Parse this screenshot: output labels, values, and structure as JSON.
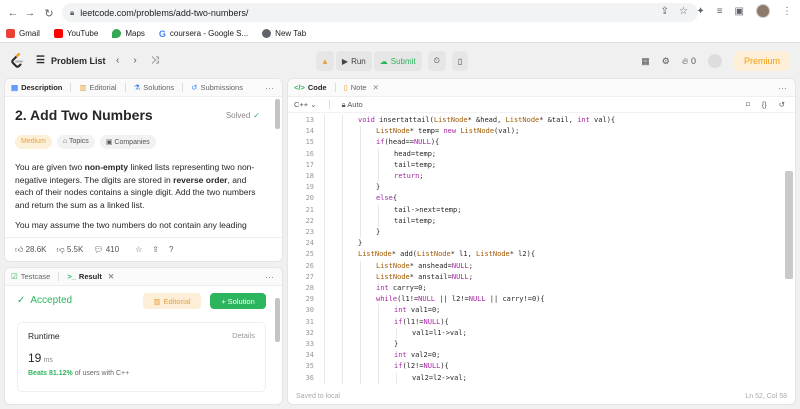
{
  "browser": {
    "url": "leetcode.com/problems/add-two-numbers/",
    "bookmarks": [
      {
        "label": "Gmail",
        "color": "#ea4335"
      },
      {
        "label": "YouTube",
        "color": "#ff0000"
      },
      {
        "label": "Maps",
        "color": "#34a853"
      },
      {
        "label": "coursera - Google S...",
        "color": "#4285f4"
      },
      {
        "label": "New Tab",
        "color": "#5f6368"
      }
    ]
  },
  "toolbar": {
    "problem_list": "Problem List",
    "run": "Run",
    "submit": "Submit",
    "streak": "0",
    "premium": "Premium"
  },
  "description_panel": {
    "tabs": [
      "Description",
      "Editorial",
      "Solutions",
      "Submissions"
    ],
    "title": "2. Add Two Numbers",
    "solved": "Solved",
    "chips": [
      "Medium",
      "Topics",
      "Companies"
    ],
    "para1_a": "You are given two ",
    "para1_b": "non-empty",
    "para1_c": " linked lists representing two non-negative integers. The digits are stored in ",
    "para1_d": "reverse order",
    "para1_e": ", and each of their nodes contains a single digit. Add the two numbers and return the sum as a linked list.",
    "para2": "You may assume the two numbers do not contain any leading",
    "likes": "28.6K",
    "dislikes": "5.5K",
    "comments": "410"
  },
  "result_panel": {
    "tabs": [
      "Testcase",
      "Result"
    ],
    "status": "Accepted",
    "editorial_btn": "Editorial",
    "solution_btn": "+ Solution",
    "runtime_label": "Runtime",
    "details": "Details",
    "runtime_value": "19",
    "runtime_unit": "ms",
    "beats_a": "Beats 81.12%",
    "beats_b": " of users with C++"
  },
  "code_panel": {
    "tabs": [
      "Code",
      "Note"
    ],
    "language": "C++",
    "auto": "Auto",
    "footer_left": "Saved to local",
    "footer_right": "Ln 52, Col 58",
    "lines": [
      {
        "n": "13",
        "indent": 2,
        "text": "void insertattail(ListNode* &head, ListNode* &tail, int val){"
      },
      {
        "n": "14",
        "indent": 3,
        "text": "ListNode* temp= new ListNode(val);"
      },
      {
        "n": "15",
        "indent": 3,
        "text": "if(head==NULL){"
      },
      {
        "n": "16",
        "indent": 4,
        "text": "head=temp;"
      },
      {
        "n": "17",
        "indent": 4,
        "text": "tail=temp;"
      },
      {
        "n": "18",
        "indent": 4,
        "text": "return;"
      },
      {
        "n": "19",
        "indent": 3,
        "text": "}"
      },
      {
        "n": "20",
        "indent": 3,
        "text": "else{"
      },
      {
        "n": "21",
        "indent": 4,
        "text": "tail->next=temp;"
      },
      {
        "n": "22",
        "indent": 4,
        "text": "tail=temp;"
      },
      {
        "n": "23",
        "indent": 3,
        "text": "}"
      },
      {
        "n": "24",
        "indent": 2,
        "text": "}"
      },
      {
        "n": "25",
        "indent": 2,
        "text": "ListNode* add(ListNode* l1, ListNode* l2){"
      },
      {
        "n": "26",
        "indent": 3,
        "text": "ListNode* anshead=NULL;"
      },
      {
        "n": "27",
        "indent": 3,
        "text": "ListNode* anstail=NULL;"
      },
      {
        "n": "28",
        "indent": 3,
        "text": "int carry=0;"
      },
      {
        "n": "29",
        "indent": 3,
        "text": "while(l1!=NULL || l2!=NULL || carry!=0){"
      },
      {
        "n": "30",
        "indent": 4,
        "text": "int val1=0;"
      },
      {
        "n": "31",
        "indent": 4,
        "text": "if(l1!=NULL){"
      },
      {
        "n": "32",
        "indent": 5,
        "text": "val1=l1->val;"
      },
      {
        "n": "33",
        "indent": 4,
        "text": "}"
      },
      {
        "n": "34",
        "indent": 4,
        "text": "int val2=0;"
      },
      {
        "n": "35",
        "indent": 4,
        "text": "if(l2!=NULL){"
      },
      {
        "n": "36",
        "indent": 5,
        "text": "val2=l2->val;"
      }
    ]
  }
}
